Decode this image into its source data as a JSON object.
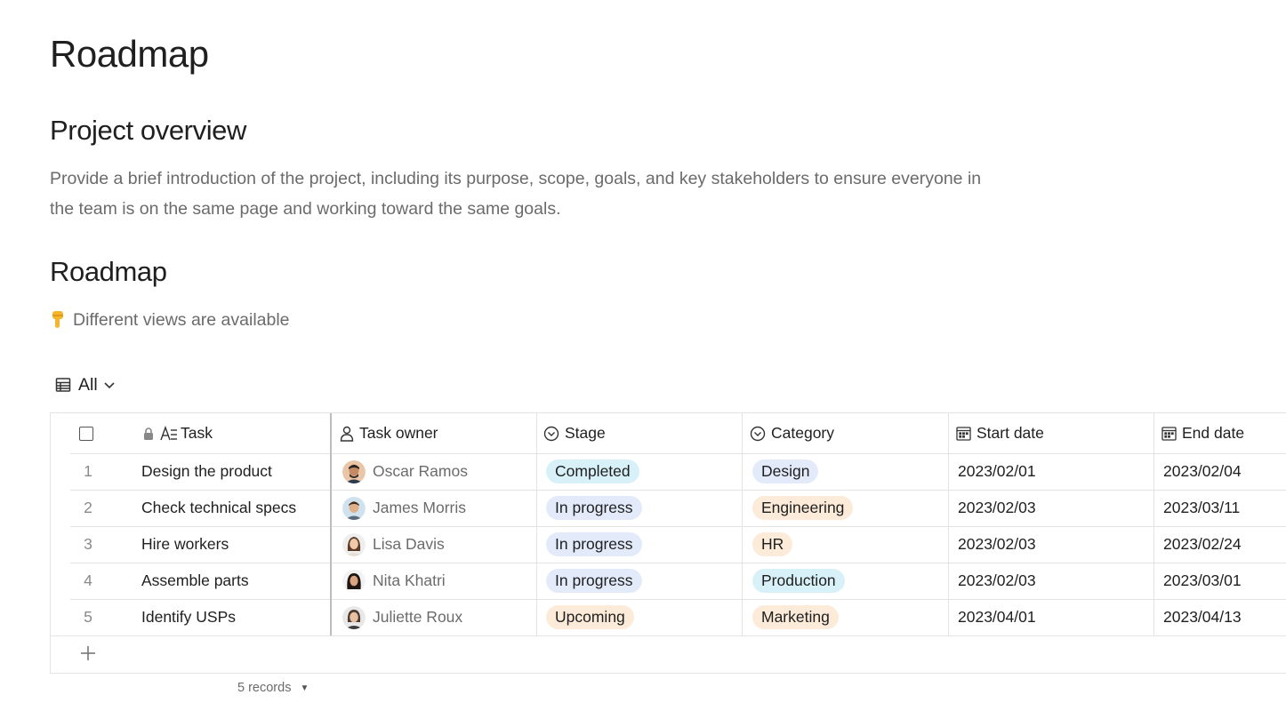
{
  "page": {
    "title": "Roadmap",
    "overview_heading": "Project overview",
    "overview_text": "Provide a brief introduction of the project, including its purpose, scope, goals, and key stakeholders to ensure everyone in the team is on the same page and working toward the same goals.",
    "roadmap_heading": "Roadmap",
    "hint_text": "Different views are available"
  },
  "view": {
    "label": "All",
    "icon": "table-icon"
  },
  "table": {
    "columns": [
      {
        "label": "Task",
        "icon": "text-icon"
      },
      {
        "label": "Task owner",
        "icon": "person-icon"
      },
      {
        "label": "Stage",
        "icon": "select-icon"
      },
      {
        "label": "Category",
        "icon": "select-icon"
      },
      {
        "label": "Start date",
        "icon": "calendar-icon"
      },
      {
        "label": "End date",
        "icon": "calendar-icon"
      }
    ],
    "rows": [
      {
        "num": "1",
        "task": "Design the product",
        "owner": "Oscar Ramos",
        "stage": "Completed",
        "category": "Design",
        "start": "2023/02/01",
        "end": "2023/02/04"
      },
      {
        "num": "2",
        "task": "Check technical specs",
        "owner": "James Morris",
        "stage": "In progress",
        "category": "Engineering",
        "start": "2023/02/03",
        "end": "2023/03/11"
      },
      {
        "num": "3",
        "task": "Hire workers",
        "owner": "Lisa Davis",
        "stage": "In progress",
        "category": "HR",
        "start": "2023/02/03",
        "end": "2023/02/24"
      },
      {
        "num": "4",
        "task": "Assemble parts",
        "owner": "Nita Khatri",
        "stage": "In progress",
        "category": "Production",
        "start": "2023/02/03",
        "end": "2023/03/01"
      },
      {
        "num": "5",
        "task": "Identify USPs",
        "owner": "Juliette Roux",
        "stage": "Upcoming",
        "category": "Marketing",
        "start": "2023/04/01",
        "end": "2023/04/13"
      }
    ],
    "records_label": "5 records"
  },
  "colors": {
    "stage_completed": "#d8f1f8",
    "stage_in_progress": "#e3ebfb",
    "stage_upcoming": "#fcebd8",
    "cat_design": "#e3ebfb",
    "cat_engineering": "#fcebd8",
    "cat_hr": "#fcebd8",
    "cat_production": "#d8f1f8",
    "cat_marketing": "#fcebd8"
  }
}
